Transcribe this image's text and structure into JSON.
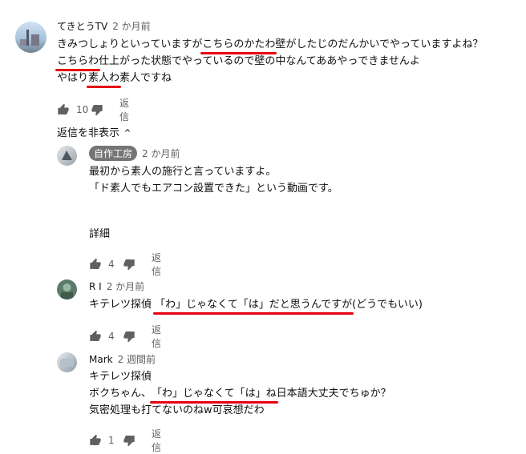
{
  "comments": [
    {
      "author": "てきとうTV",
      "time": "2 か月前",
      "lines": [
        [
          "きみつしょりといっていますが",
          "こちらのかたわ",
          "壁がしたじのだんかいでやっていますよね？"
        ],
        [
          "",
          "こちらわ",
          "仕上がった状態でやっているので壁の中なんてああやっできませんよ"
        ],
        [
          "やはり",
          "素人わ",
          "素人ですね"
        ]
      ],
      "likes": "10",
      "reply": "返信"
    }
  ],
  "hide_replies": "返信を非表示",
  "replies": [
    {
      "author": "自作工房",
      "time": "2 か月前",
      "lines": [
        "最初から素人の施行と言っていますよ。",
        "「ド素人でもエアコン設置できた」という動画です。"
      ],
      "more": "詳細",
      "likes": "4",
      "reply": "返信"
    },
    {
      "author": "R I",
      "time": "2 か月前",
      "line": [
        "キテレツ探偵 ",
        "「わ」じゃなくて「は」だと思うんですが",
        "(どうでもいい)"
      ],
      "likes": "4",
      "reply": "返信"
    },
    {
      "author": "Mark",
      "time": "2 週間前",
      "lines": [
        [
          "キテレツ探偵",
          "",
          ""
        ],
        [
          "ボクちゃん、",
          "「わ」じゃなくて「は」ね",
          "日本語大丈夫でちゅか？"
        ],
        [
          "気密処理も打てないのねw可哀想だわ",
          "",
          ""
        ]
      ],
      "likes": "1",
      "reply": "返信"
    }
  ]
}
